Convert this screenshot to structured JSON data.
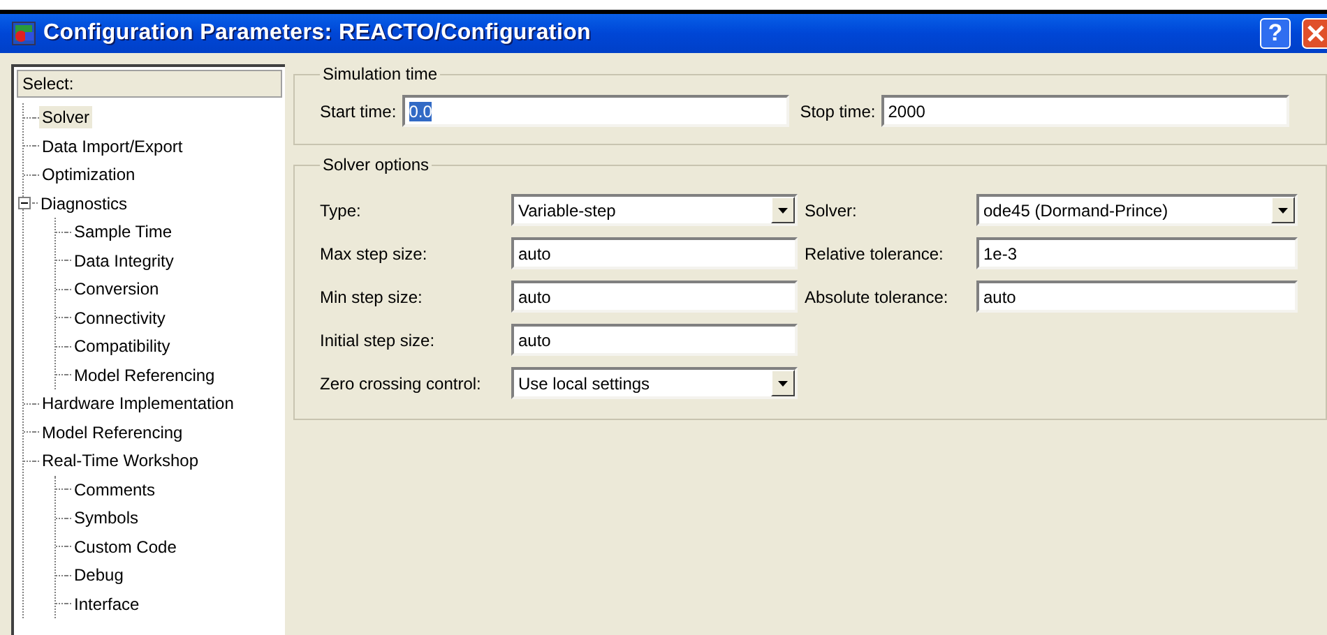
{
  "window": {
    "title": "Configuration Parameters: REACTO/Configuration",
    "help_button": "?"
  },
  "tree": {
    "header": "Select:",
    "items": [
      {
        "label": "Solver",
        "selected": true
      },
      {
        "label": "Data Import/Export",
        "selected": false
      },
      {
        "label": "Optimization",
        "selected": false
      },
      {
        "label": "Diagnostics",
        "selected": false,
        "expanded": true,
        "children": [
          {
            "label": "Sample Time",
            "selected": false
          },
          {
            "label": "Data Integrity",
            "selected": false
          },
          {
            "label": "Conversion",
            "selected": false
          },
          {
            "label": "Connectivity",
            "selected": false
          },
          {
            "label": "Compatibility",
            "selected": false
          },
          {
            "label": "Model Referencing",
            "selected": false
          }
        ]
      },
      {
        "label": "Hardware Implementation",
        "selected": false
      },
      {
        "label": "Model Referencing",
        "selected": false
      },
      {
        "label": "Real-Time Workshop",
        "selected": false,
        "children": [
          {
            "label": "Comments",
            "selected": false
          },
          {
            "label": "Symbols",
            "selected": false
          },
          {
            "label": "Custom Code",
            "selected": false
          },
          {
            "label": "Debug",
            "selected": false
          },
          {
            "label": "Interface",
            "selected": false
          }
        ]
      }
    ]
  },
  "simulation_time": {
    "title": "Simulation time",
    "fields": [
      {
        "label": "Start time:",
        "value": "0.0",
        "text_selected": true
      },
      {
        "label": "Stop time:",
        "value": "2000",
        "text_selected": false
      }
    ]
  },
  "solver_options": {
    "title": "Solver options",
    "left": [
      {
        "label": "Type:",
        "value": "Variable-step",
        "kind": "dropdown"
      },
      {
        "label": "Max step size:",
        "value": "auto",
        "kind": "text"
      },
      {
        "label": "Min step size:",
        "value": "auto",
        "kind": "text"
      },
      {
        "label": "Initial step size:",
        "value": "auto",
        "kind": "text"
      },
      {
        "label": "Zero crossing control:",
        "value": "Use local settings",
        "kind": "dropdown"
      }
    ],
    "right": [
      {
        "label": "Solver:",
        "value": "ode45 (Dormand-Prince)",
        "kind": "dropdown"
      },
      {
        "label": "Relative tolerance:",
        "value": "1e-3",
        "kind": "text"
      },
      {
        "label": "Absolute tolerance:",
        "value": "auto",
        "kind": "text"
      }
    ]
  }
}
